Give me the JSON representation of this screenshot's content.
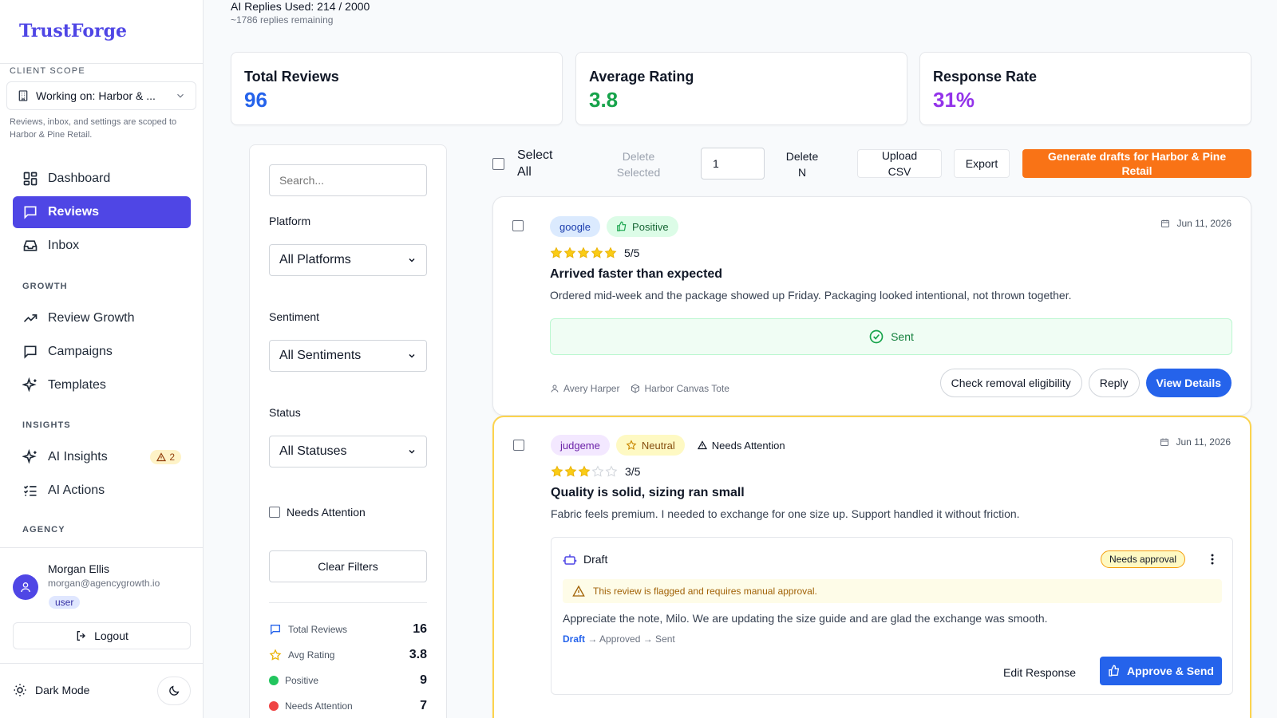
{
  "brand": {
    "name": "TrustForge"
  },
  "sidebar": {
    "scope_label": "CLIENT SCOPE",
    "scope_value": "Working on: Harbor & ...",
    "scope_note": "Reviews, inbox, and settings are scoped to Harbor & Pine Retail.",
    "nav_main": [
      {
        "label": "Dashboard",
        "icon": "dashboard-icon"
      },
      {
        "label": "Reviews",
        "icon": "message-icon",
        "active": true
      },
      {
        "label": "Inbox",
        "icon": "inbox-icon"
      }
    ],
    "growth_label": "GROWTH",
    "nav_growth": [
      {
        "label": "Review Growth",
        "icon": "trending-up-icon"
      },
      {
        "label": "Campaigns",
        "icon": "message-icon"
      },
      {
        "label": "Templates",
        "icon": "sparkles-icon"
      }
    ],
    "insights_label": "INSIGHTS",
    "nav_insights": [
      {
        "label": "AI Insights",
        "icon": "sparkles-icon",
        "badge": "2"
      },
      {
        "label": "AI Actions",
        "icon": "checklist-icon"
      }
    ],
    "agency_label": "AGENCY",
    "user": {
      "name": "Morgan Ellis",
      "email": "morgan@agencygrowth.io",
      "role": "user"
    },
    "logout_label": "Logout",
    "dark_mode_label": "Dark Mode"
  },
  "header": {
    "quota_main": "AI Replies Used: 214 / 2000",
    "quota_sub": "~1786 replies remaining"
  },
  "stats": [
    {
      "label": "Total Reviews",
      "value": "96",
      "color": "#2563eb"
    },
    {
      "label": "Average Rating",
      "value": "3.8",
      "color": "#16a34a"
    },
    {
      "label": "Response Rate",
      "value": "31%",
      "color": "#9333ea"
    }
  ],
  "filters": {
    "search_placeholder": "Search...",
    "platform_label": "Platform",
    "platform_value": "All Platforms",
    "sentiment_label": "Sentiment",
    "sentiment_value": "All Sentiments",
    "status_label": "Status",
    "status_value": "All Statuses",
    "needs_attention_label": "Needs Attention",
    "clear_label": "Clear Filters",
    "summary": [
      {
        "label": "Total Reviews",
        "value": "16",
        "icon": "message-icon"
      },
      {
        "label": "Avg Rating",
        "value": "3.8",
        "icon": "star-icon"
      },
      {
        "label": "Positive",
        "value": "9",
        "icon": "green-dot-icon"
      },
      {
        "label": "Needs Attention",
        "value": "7",
        "icon": "red-dot-icon"
      }
    ]
  },
  "toolbar": {
    "select_all_line1": "Select",
    "select_all_line2": "All",
    "delete_selected_line1": "Delete",
    "delete_selected_line2": "Selected",
    "delete_n_value": "1",
    "delete_n_line1": "Delete",
    "delete_n_line2": "N",
    "upload_line1": "Upload",
    "upload_line2": "CSV",
    "export_label": "Export",
    "generate_line1": "Generate drafts for Harbor & Pine",
    "generate_line2": "Retail"
  },
  "reviews": [
    {
      "platform": "google",
      "sentiment": "Positive",
      "date": "Jun 11, 2026",
      "rating": 5,
      "rating_text": "5/5",
      "title": "Arrived faster than expected",
      "body": "Ordered mid-week and the package showed up Friday. Packaging looked intentional, not thrown together.",
      "status_text": "Sent",
      "author": "Avery Harper",
      "product": "Harbor Canvas Tote",
      "actions": {
        "check": "Check removal eligibility",
        "reply": "Reply",
        "details": "View Details"
      }
    },
    {
      "platform": "judgeme",
      "sentiment": "Neutral",
      "attention": "Needs Attention",
      "date": "Jun 11, 2026",
      "rating": 3,
      "rating_text": "3/5",
      "title": "Quality is solid, sizing ran small",
      "body": "Fabric feels premium. I needed to exchange for one size up. Support handled it without friction.",
      "draft": {
        "label": "Draft",
        "badge": "Needs approval",
        "flag_text": "This review is flagged and requires manual approval.",
        "text": "Appreciate the note, Milo. We are updating the size guide and are glad the exchange was smooth.",
        "workflow_current": "Draft",
        "workflow_rest": " → Approved → Sent",
        "edit_label": "Edit Response",
        "approve_label": "Approve & Send"
      }
    }
  ],
  "colors": {
    "accent": "#4f46e5",
    "primary_button": "#2563eb",
    "generate_button": "#f97316",
    "attention_border": "#fcd34d"
  }
}
